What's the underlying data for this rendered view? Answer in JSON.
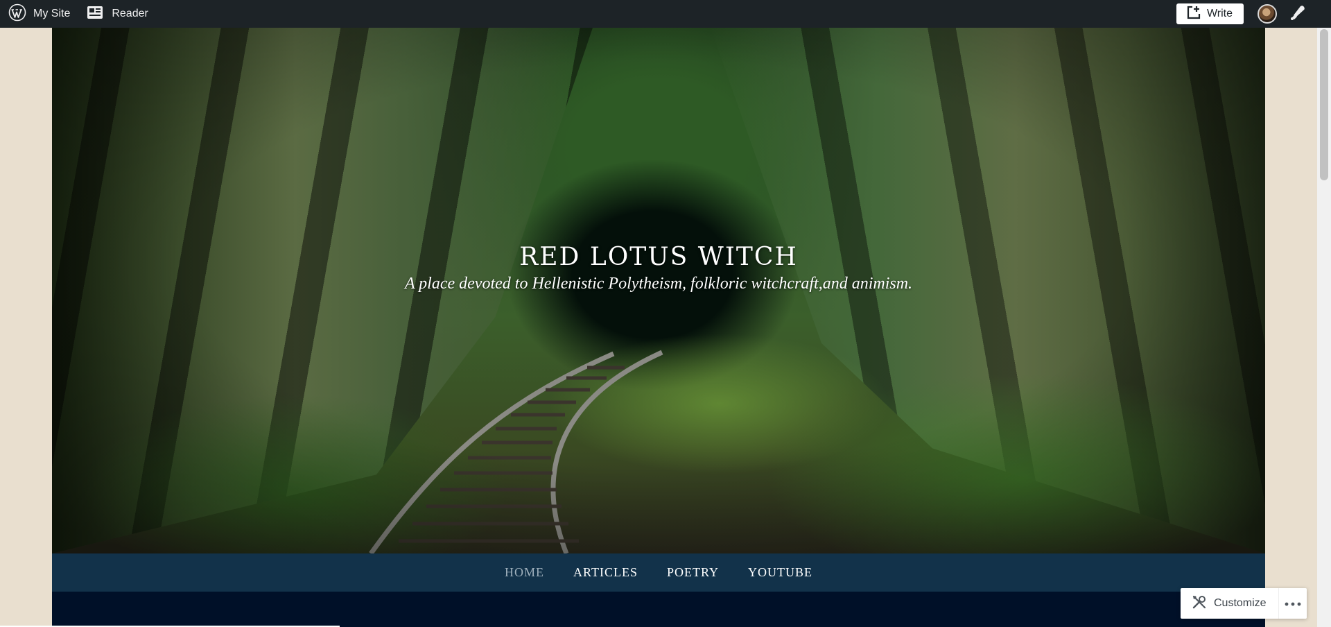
{
  "adminbar": {
    "mysite_label": "My Site",
    "reader_label": "Reader",
    "write_label": "Write",
    "icons": [
      "wordpress-icon",
      "reader-icon",
      "write-icon",
      "avatar",
      "notifications-icon"
    ]
  },
  "site": {
    "title": "RED LOTUS WITCH",
    "tagline": "A place devoted to Hellenistic Polytheism, folkloric witchcraft,and animism."
  },
  "nav": {
    "items": [
      {
        "label": "HOME",
        "current": true
      },
      {
        "label": "ARTICLES",
        "current": false
      },
      {
        "label": "POETRY",
        "current": false
      },
      {
        "label": "YOUTUBE",
        "current": false
      }
    ]
  },
  "customize": {
    "label": "Customize"
  },
  "colors": {
    "adminbar_bg": "#1d2327",
    "nav_bg": "#12324a",
    "page_bg": "#e9dfcf",
    "content_bg": "#001028"
  }
}
